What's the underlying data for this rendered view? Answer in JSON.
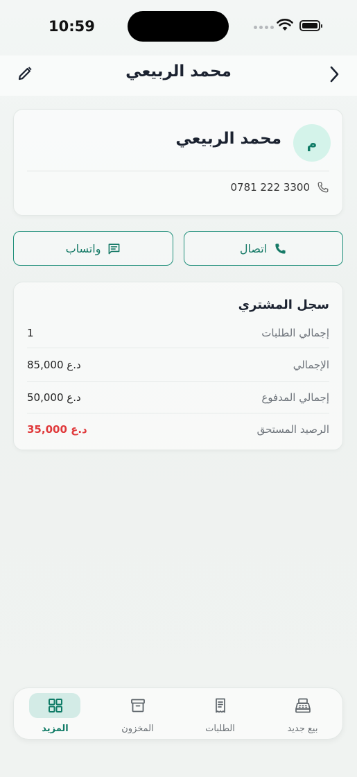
{
  "status": {
    "time": "10:59"
  },
  "header": {
    "title": "محمد الربيعي"
  },
  "profile": {
    "initial": "م",
    "name": "محمد الربيعي",
    "phone": "0781 222 3300"
  },
  "actions": {
    "call_label": "اتصال",
    "whatsapp_label": "واتساب"
  },
  "history": {
    "title": "سجل المشتري",
    "rows": [
      {
        "label": "إجمالي الطلبات",
        "value": "1"
      },
      {
        "label": "الإجمالي",
        "value": "85,000 د.ع"
      },
      {
        "label": "إجمالي المدفوع",
        "value": "50,000 د.ع"
      },
      {
        "label": "الرصيد المستحق",
        "value": "35,000 د.ع"
      }
    ]
  },
  "tabs": [
    {
      "label": "بيع جديد",
      "icon": "cash-register-icon"
    },
    {
      "label": "الطلبات",
      "icon": "receipt-icon"
    },
    {
      "label": "المخزون",
      "icon": "archive-box-icon"
    },
    {
      "label": "المزيد",
      "icon": "grid-icon",
      "active": true
    }
  ],
  "colors": {
    "accent": "#1f8f7a",
    "due": "#e0393b",
    "avatar_bg": "#d4f3ea"
  }
}
